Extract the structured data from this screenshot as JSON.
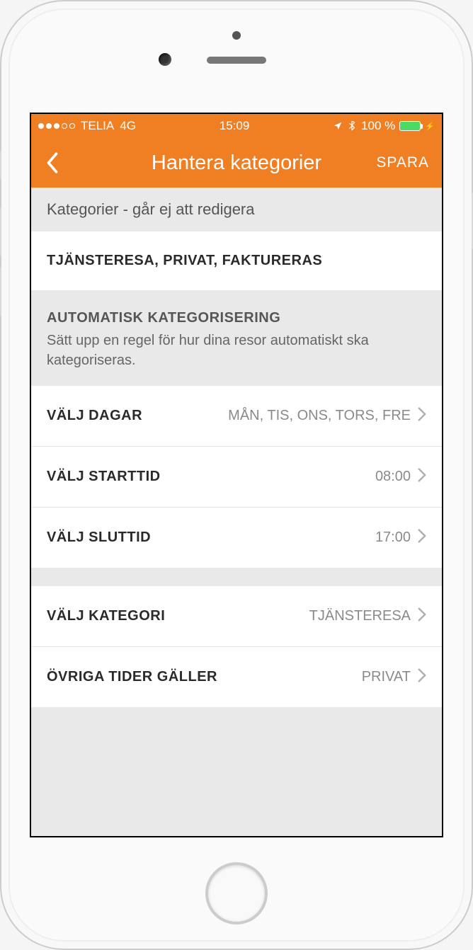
{
  "status": {
    "carrier": "TELIA",
    "network": "4G",
    "time": "15:09",
    "battery_text": "100 %"
  },
  "nav": {
    "title": "Hantera kategorier",
    "save": "SPARA"
  },
  "sections": {
    "locked_header": "Kategorier - går ej att redigera",
    "locked_value": "TJÄNSTERESA, PRIVAT, FAKTURERAS",
    "auto_title": "AUTOMATISK KATEGORISERING",
    "auto_subtitle": "Sätt upp en regel för hur dina resor automatiskt ska kategoriseras."
  },
  "rows": {
    "days": {
      "label": "VÄLJ DAGAR",
      "value": "MÅN, TIS, ONS, TORS, FRE"
    },
    "start": {
      "label": "VÄLJ STARTTID",
      "value": "08:00"
    },
    "end": {
      "label": "VÄLJ SLUTTID",
      "value": "17:00"
    },
    "category": {
      "label": "VÄLJ KATEGORI",
      "value": "TJÄNSTERESA"
    },
    "other": {
      "label": "ÖVRIGA TIDER GÄLLER",
      "value": "PRIVAT"
    }
  }
}
